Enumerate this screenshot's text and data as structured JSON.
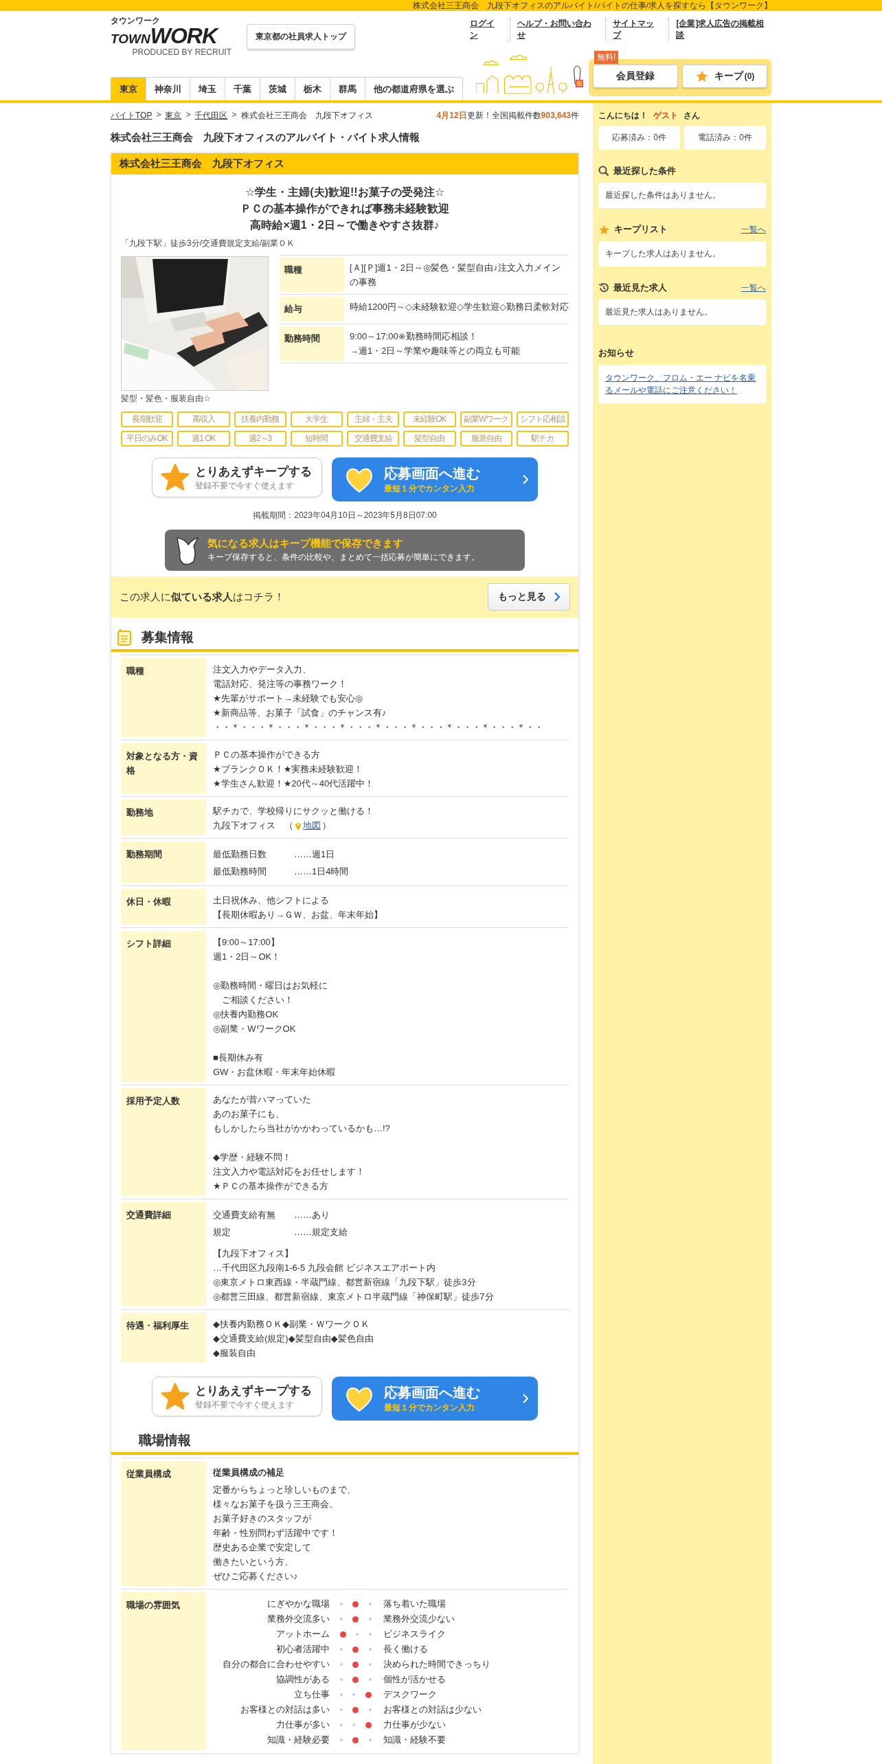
{
  "top_bar": {
    "text": "株式会社三王商会　九段下オフィスのアルバイト/バイトの仕事/求人を探すなら【タウンワーク】"
  },
  "header": {
    "logo": {
      "kana": "タウンワーク",
      "town": "TOWN",
      "work": "WORK",
      "credit": "PRODUCED BY RECRUIT"
    },
    "top_button": "東京都の社員求人トップ",
    "links": [
      "ログイン",
      "ヘルプ・お問い合わせ",
      "サイトマップ",
      "[企業]求人広告の掲載相談"
    ],
    "regions": [
      {
        "label": "東京",
        "selected": true
      },
      {
        "label": "神奈川",
        "selected": false
      },
      {
        "label": "埼玉",
        "selected": false
      },
      {
        "label": "千葉",
        "selected": false
      },
      {
        "label": "茨城",
        "selected": false
      },
      {
        "label": "栃木",
        "selected": false
      },
      {
        "label": "群馬",
        "selected": false
      },
      {
        "label": "他の都道府県を選ぶ",
        "selected": false
      }
    ],
    "member": {
      "badge": "無料!",
      "register": "会員登録",
      "keep": "キープ",
      "keep_count": "(0)"
    }
  },
  "breadcrumb": [
    {
      "label": "バイトTOP",
      "link": true
    },
    {
      "sep": ">",
      "label": "東京",
      "link": true
    },
    {
      "sep": ">",
      "label": "千代田区",
      "link": true
    },
    {
      "sep": ">",
      "label": "株式会社三王商会　九段下オフィス",
      "link": false
    }
  ],
  "update": {
    "date": "4月12日",
    "label": "更新！全国掲載件数",
    "count": "903,643",
    "unit": "件"
  },
  "page_title": "株式会社三王商会　九段下オフィスのアルバイト・バイト求人情報",
  "job": {
    "company": "株式会社三王商会　九段下オフィス",
    "catch": [
      "☆学生・主婦(夫)歓迎!!お菓子の受発注☆",
      "ＰＣの基本操作ができれば事務未経験歓迎",
      "高時給×週1・2日～で働きやすさ抜群♪"
    ],
    "access": "「九段下駅」徒歩3分/交通費規定支給/副業ＯＫ",
    "photo_caption": "髪型・髪色・服装自由☆",
    "summary": [
      {
        "label": "職種",
        "value": "[Ａ][Ｐ]週1・2日～◎髪色・髪型自由♪注文入力メインの事務"
      },
      {
        "label": "給与",
        "value": "時給1200円～◇未経験歓迎◇学生歓迎◇勤務日柔軟対応"
      },
      {
        "label": "勤務時間",
        "value": "9:00～17:00※勤務時間応相談！\n→週1・2日～学業や趣味等との両立も可能"
      }
    ],
    "tags": [
      "長期歓迎",
      "高収入",
      "扶養内勤務",
      "大学生",
      "主婦・主夫",
      "未経験OK",
      "副業Wワーク",
      "シフト応相談",
      "平日のみOK",
      "週1 OK",
      "週2～3",
      "短時間",
      "交通費支給",
      "髪型自由",
      "服装自由",
      "駅チカ"
    ],
    "actions": {
      "keep_title": "とりあえずキープする",
      "keep_sub": "登録不要で今すぐ使えます",
      "apply_title": "応募画面へ進む",
      "apply_sub": "最短１分でカンタン入力"
    },
    "period": "掲載期間：2023年04月10日～2023年5月8日07:00"
  },
  "keep_banner": {
    "title": "気になる求人はキープ機能で保存できます",
    "text": "キープ保存すると、条件の比較や、まとめて一括応募が簡単にできます。"
  },
  "similar": {
    "text": "この求人に**似ている求人**はコチラ！",
    "button": "もっと見る"
  },
  "recruit": {
    "title": "募集情報",
    "rows": [
      {
        "label": "職種",
        "kind": "text",
        "paragraphs": [
          [
            "注文入力やデータ入力、",
            "電話対応、発注等の事務ワーク！",
            "★先輩がサポート→未経験でも安心◎",
            "★新商品等、お菓子「試食」のチャンス有♪",
            "・・＊・・・＊・・・＊・・・＊・・・＊・・・＊・・・＊・・・＊・・・＊・・"
          ]
        ]
      },
      {
        "label": "対象となる方・資格",
        "kind": "text",
        "paragraphs": [
          [
            "ＰＣの基本操作ができる方",
            "★ブランクＯＫ！★実務未経験歓迎！",
            "★学生さん歓迎！★20代～40代活躍中！"
          ]
        ]
      },
      {
        "label": "勤務地",
        "kind": "location",
        "paragraphs": [
          [
            "駅チカで、学校帰りにサクッと働ける！"
          ]
        ],
        "place": "九段下オフィス　（",
        "map_link": "地図",
        "close": "）"
      },
      {
        "label": "勤務期間",
        "kind": "pairs",
        "pairs": [
          {
            "term": "最低勤務日数",
            "value": "……週1日"
          },
          {
            "term": "最低勤務時間",
            "value": "……1日4時間"
          }
        ]
      },
      {
        "label": "休日・休暇",
        "kind": "text",
        "paragraphs": [
          [
            "土日祝休み、他シフトによる",
            "【長期休暇あり→ＧＷ、お盆、年末年始】"
          ]
        ]
      },
      {
        "label": "シフト詳細",
        "kind": "text",
        "paragraphs": [
          [
            "【9:00～17:00】",
            "週1・2日～OK！"
          ],
          [
            "◎勤務時間・曜日はお気軽に",
            "　ご相談ください！",
            "◎扶養内勤務OK",
            "◎副業・WワークOK"
          ],
          [
            "■長期休み有",
            "GW・お盆休暇・年末年始休暇"
          ]
        ]
      },
      {
        "label": "採用予定人数",
        "kind": "text",
        "paragraphs": [
          [
            "あなたが昔ハマっていた",
            "あのお菓子にも、",
            "もしかしたら当社がかかわっているかも…!?"
          ],
          [
            "◆学歴・経験不問！",
            "注文入力や電話対応をお任せします！",
            "★ＰＣの基本操作ができる方"
          ]
        ]
      },
      {
        "label": "交通費詳細",
        "kind": "pairs",
        "pairs": [
          {
            "term": "交通費支給有無",
            "value": "……あり"
          },
          {
            "term": "規定",
            "value": "……規定支給"
          }
        ],
        "paragraphs": [
          [
            "【九段下オフィス】",
            "…千代田区九段南1-6-5 九段会館 ビジネスエアポート内",
            "◎東京メトロ東西線・半蔵門線、都営新宿線「九段下駅」徒歩3分",
            "◎都営三田線、都営新宿線、東京メトロ半蔵門線「神保町駅」徒歩7分"
          ]
        ]
      },
      {
        "label": "待遇・福利厚生",
        "kind": "text",
        "paragraphs": [
          [
            "◆扶養内勤務ＯＫ◆副業・ＷワークＯＫ",
            "◆交通費支給(規定)◆髪型自由◆髪色自由",
            "◆服装自由"
          ]
        ]
      }
    ]
  },
  "actions_bottom": {
    "keep_title": "とりあえずキープする",
    "keep_sub": "登録不要で今すぐ使えます",
    "apply_title": "応募画面へ進む",
    "apply_sub": "最短１分でカンタン入力"
  },
  "workplace": {
    "title": "職場情報",
    "rows": [
      {
        "label": "従業員構成",
        "kind": "composition",
        "heading": "従業員構成の補足",
        "paragraphs": [
          [
            "定番からちょっと珍しいものまで、",
            "様々なお菓子を扱う三王商会。",
            "お菓子好きのスタッフが",
            "年齢・性別問わず活躍中です！",
            "歴史ある企業で安定して",
            "働きたいという方、",
            "ぜひご応募ください♪"
          ]
        ]
      },
      {
        "label": "職場の雰囲気",
        "kind": "atmosphere",
        "scales": [
          {
            "left": "にぎやかな職場",
            "right": "落ち着いた職場",
            "dots": [
              {
                "on": false
              },
              {
                "on": true
              },
              {
                "on": false
              }
            ]
          },
          {
            "left": "業務外交流多い",
            "right": "業務外交流少ない",
            "dots": [
              {
                "on": false
              },
              {
                "on": true
              },
              {
                "on": false
              }
            ]
          },
          {
            "left": "アットホーム",
            "right": "ビジネスライク",
            "dots": [
              {
                "on": true
              },
              {
                "on": false
              },
              {
                "on": false
              }
            ]
          },
          {
            "left": "初心者活躍中",
            "right": "長く働ける",
            "dots": [
              {
                "on": false
              },
              {
                "on": true
              },
              {
                "on": false
              }
            ]
          },
          {
            "left": "自分の都合に合わせやすい",
            "right": "決められた時間できっちり",
            "dots": [
              {
                "on": false
              },
              {
                "on": true
              },
              {
                "on": false
              }
            ]
          },
          {
            "left": "協調性がある",
            "right": "個性が活かせる",
            "dots": [
              {
                "on": false
              },
              {
                "on": true
              },
              {
                "on": false
              }
            ]
          },
          {
            "left": "立ち仕事",
            "right": "デスクワーク",
            "dots": [
              {
                "on": false
              },
              {
                "on": false
              },
              {
                "on": true
              }
            ]
          },
          {
            "left": "お客様との対話は多い",
            "right": "お客様との対話は少ない",
            "dots": [
              {
                "on": false
              },
              {
                "on": true
              },
              {
                "on": false
              }
            ]
          },
          {
            "left": "力仕事が多い",
            "right": "力仕事が少ない",
            "dots": [
              {
                "on": false
              },
              {
                "on": false
              },
              {
                "on": true
              }
            ]
          },
          {
            "left": "知識・経験必要",
            "right": "知識・経験不要",
            "dots": [
              {
                "on": false
              },
              {
                "on": true
              },
              {
                "on": false
              }
            ]
          }
        ]
      }
    ]
  },
  "sidebar": {
    "greeting": "こんにちは！",
    "guest": "ゲスト",
    "honorific": "さん",
    "counters": [
      "応募済み：0件",
      "電話済み：0件"
    ],
    "sections": [
      {
        "kind": "search",
        "title": "最近探した条件",
        "text": "最近探した条件はありません。"
      },
      {
        "kind": "keep",
        "title": "キープリスト",
        "link": "一覧へ",
        "text": "キープした求人はありません。"
      },
      {
        "kind": "history",
        "title": "最近見た求人",
        "link": "一覧へ",
        "text": "最近見た求人はありません。"
      },
      {
        "kind": "notice",
        "title": "お知らせ",
        "notice_link": "タウンワーク、フロム・エー ナビを名乗るメールや電話にご注意ください！"
      }
    ]
  }
}
